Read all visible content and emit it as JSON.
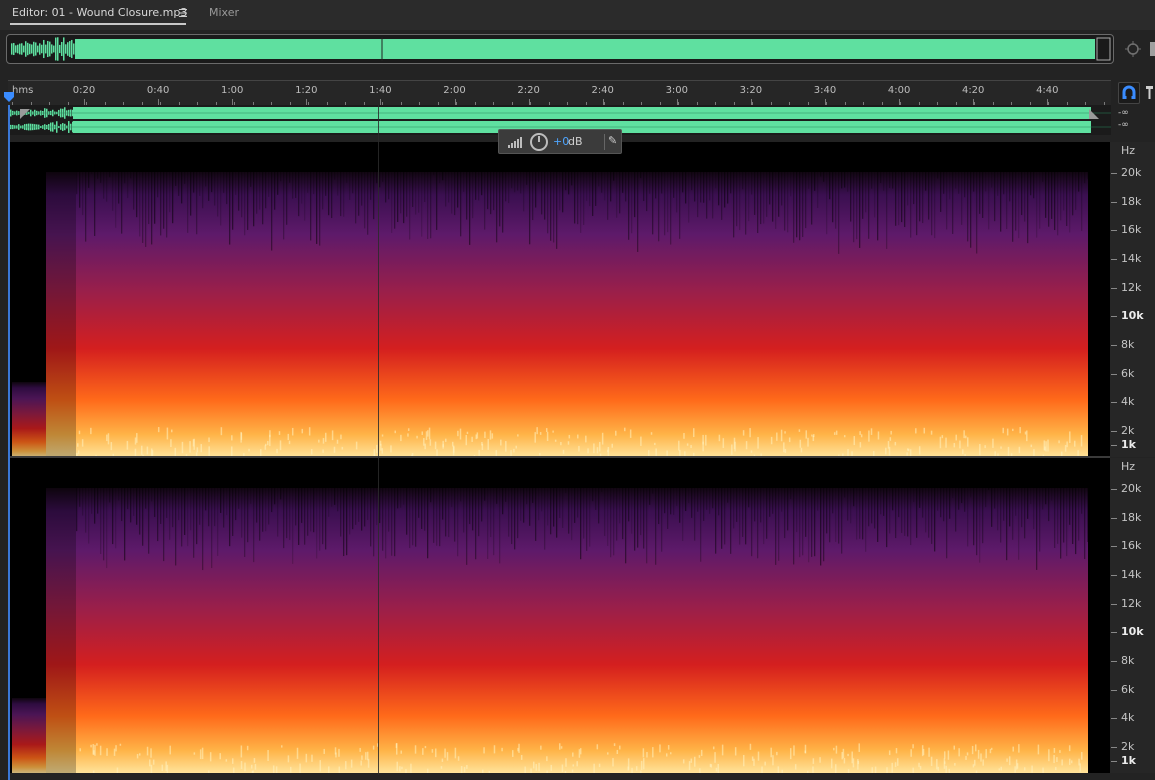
{
  "tabs": {
    "editor_label": "Editor: 01 - Wound Closure.mp3",
    "menu_glyph": "☰",
    "mixer_label": "Mixer"
  },
  "ruler": {
    "unit": "hms",
    "labels": [
      "0:20",
      "0:40",
      "1:00",
      "1:20",
      "1:40",
      "2:00",
      "2:20",
      "2:40",
      "3:00",
      "3:20",
      "3:40",
      "4:00",
      "4:20",
      "4:40"
    ]
  },
  "levels": {
    "ch1": "-∞",
    "ch2": "-∞"
  },
  "hud": {
    "gain_value": "+0",
    "gain_unit": "dB"
  },
  "freq_axis": {
    "unit": "Hz",
    "labels": [
      "20k",
      "18k",
      "16k",
      "14k",
      "12k",
      "10k",
      "8k",
      "6k",
      "4k",
      "2k",
      "1k"
    ]
  },
  "colors": {
    "waveform": "#5fe0a0",
    "accent": "#4fa6ff",
    "spectral_hot": "#ffd27a",
    "spectral_mid": "#e03a10",
    "spectral_cool": "#5a1a6e"
  },
  "icons": {
    "zoom": "zoom-target-icon",
    "playhead": "playhead-marker-icon",
    "snap": "snap-magnet-icon",
    "pin": "pin-icon"
  }
}
